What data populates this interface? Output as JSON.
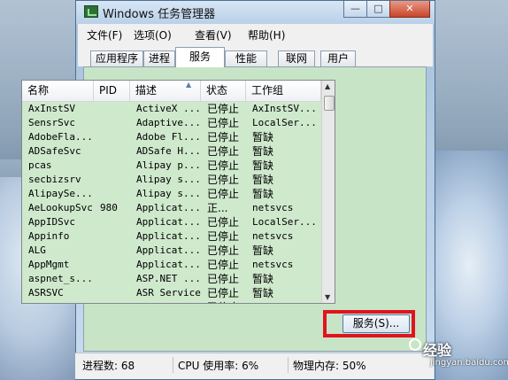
{
  "window": {
    "title": "Windows 任务管理器",
    "controls": {
      "minimize": "—",
      "maximize": "□",
      "close": "✕"
    }
  },
  "menubar": {
    "items": [
      "文件(F)",
      "选项(O)",
      "查看(V)",
      "帮助(H)"
    ]
  },
  "tabs": {
    "items": [
      "应用程序",
      "进程",
      "服务",
      "性能",
      "联网",
      "用户"
    ],
    "active": "服务"
  },
  "services_table": {
    "columns": [
      "名称",
      "PID",
      "描述",
      "状态",
      "工作组"
    ],
    "sort_column": "描述",
    "rows": [
      {
        "name": "AxInstSV",
        "pid": "",
        "desc": "ActiveX ...",
        "status": "已停止",
        "group": "AxInstSV..."
      },
      {
        "name": "SensrSvc",
        "pid": "",
        "desc": "Adaptive...",
        "status": "已停止",
        "group": "LocalSer..."
      },
      {
        "name": "AdobeFla...",
        "pid": "",
        "desc": "Adobe Fl...",
        "status": "已停止",
        "group": "暂缺"
      },
      {
        "name": "ADSafeSvc",
        "pid": "",
        "desc": "ADSafe H...",
        "status": "已停止",
        "group": "暂缺"
      },
      {
        "name": "pcas",
        "pid": "",
        "desc": "Alipay p...",
        "status": "已停止",
        "group": "暂缺"
      },
      {
        "name": "secbizsrv",
        "pid": "",
        "desc": "Alipay s...",
        "status": "已停止",
        "group": "暂缺"
      },
      {
        "name": "AlipaySe...",
        "pid": "",
        "desc": "Alipay s...",
        "status": "已停止",
        "group": "暂缺"
      },
      {
        "name": "AeLookupSvc",
        "pid": "980",
        "desc": "Applicat...",
        "status": "正...",
        "group": "netsvcs"
      },
      {
        "name": "AppIDSvc",
        "pid": "",
        "desc": "Applicat...",
        "status": "已停止",
        "group": "LocalSer..."
      },
      {
        "name": "Appinfo",
        "pid": "",
        "desc": "Applicat...",
        "status": "已停止",
        "group": "netsvcs"
      },
      {
        "name": "ALG",
        "pid": "",
        "desc": "Applicat...",
        "status": "已停止",
        "group": "暂缺"
      },
      {
        "name": "AppMgmt",
        "pid": "",
        "desc": "Applicat...",
        "status": "已停止",
        "group": "netsvcs"
      },
      {
        "name": "aspnet_s...",
        "pid": "",
        "desc": "ASP.NET ...",
        "status": "已停止",
        "group": "暂缺"
      },
      {
        "name": "ASRSVC",
        "pid": "",
        "desc": "ASR Service",
        "status": "已停止",
        "group": "暂缺"
      },
      {
        "name": "BITS",
        "pid": "",
        "desc": "Backgrou...",
        "status": "已停止",
        "group": "netsvcs"
      }
    ]
  },
  "services_button": {
    "label": "服务(S)..."
  },
  "statusbar": {
    "processes": "进程数: 68",
    "cpu": "CPU 使用率: 6%",
    "memory": "物理内存: 50%"
  },
  "watermark": {
    "text": "经验",
    "url": "jingyan.baidu.com"
  },
  "colors": {
    "list_bg": "#cfe9cd",
    "highlight_border": "#e0141f"
  }
}
